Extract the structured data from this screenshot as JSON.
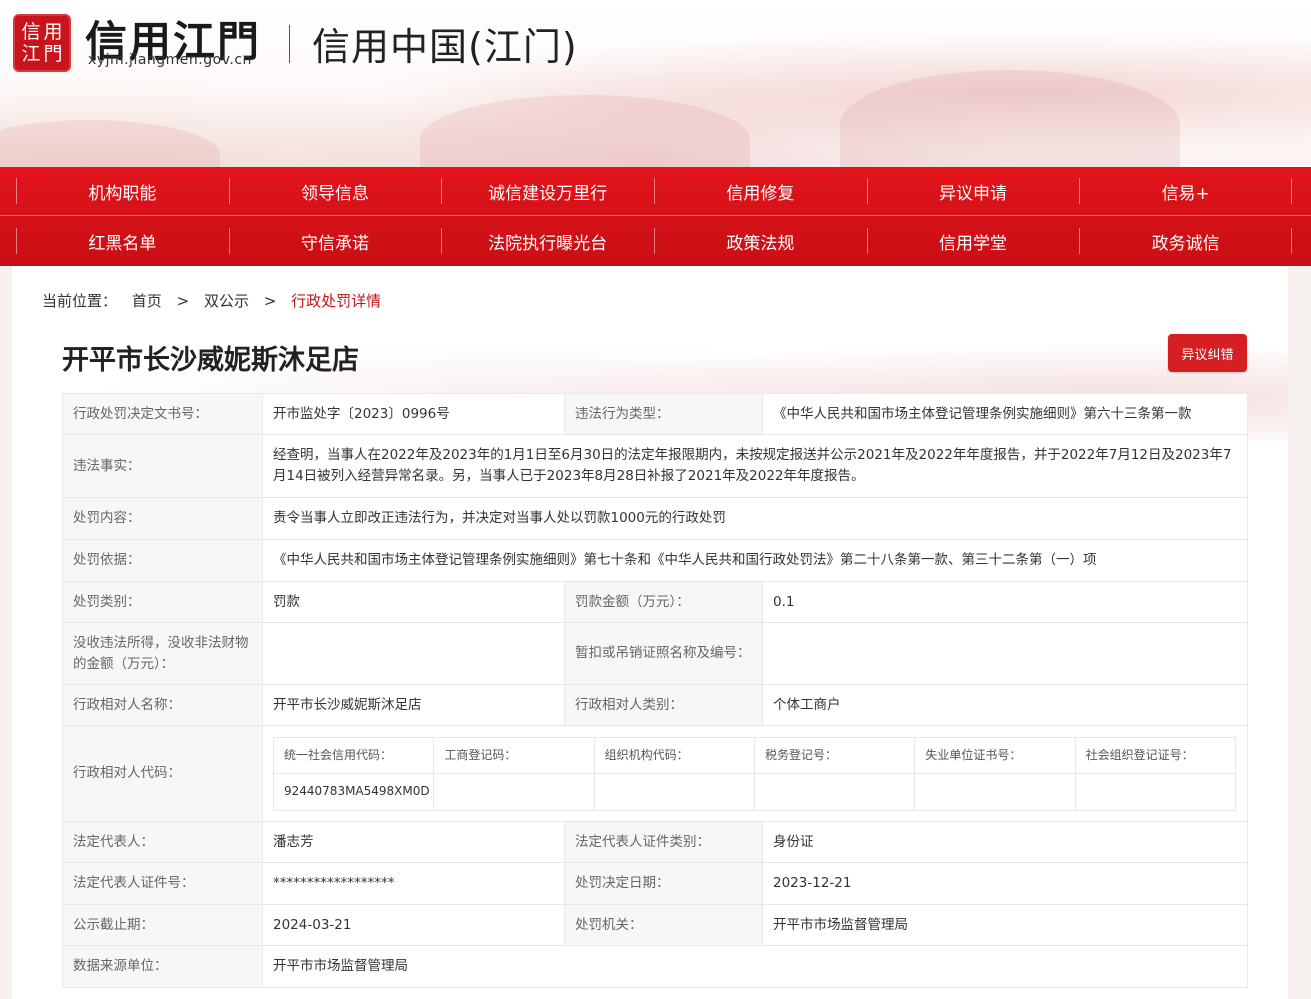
{
  "header": {
    "seal_chars": [
      "信",
      "用",
      "江",
      "門"
    ],
    "logo_text": "信用江門",
    "logo_domain": "xyjm.jiangmen.gov.cn",
    "site_name": "信用中国(江门)"
  },
  "nav": {
    "row1": [
      "机构职能",
      "领导信息",
      "诚信建设万里行",
      "信用修复",
      "异议申请",
      "信易+"
    ],
    "row2": [
      "红黑名单",
      "守信承诺",
      "法院执行曝光台",
      "政策法规",
      "信用学堂",
      "政务诚信"
    ]
  },
  "breadcrumb": {
    "label": "当前位置：",
    "home": "首页",
    "sep": ">",
    "section": "双公示",
    "current": "行政处罚详情"
  },
  "page": {
    "title": "开平市长沙威妮斯沐足店",
    "dispute_button": "异议纠错"
  },
  "detail": {
    "doc_no_label": "行政处罚决定文书号：",
    "doc_no": "开市监处字〔2023〕0996号",
    "violation_type_label": "违法行为类型：",
    "violation_type": "《中华人民共和国市场主体登记管理条例实施细则》第六十三条第一款",
    "facts_label": "违法事实：",
    "facts": "经查明，当事人在2022年及2023年的1月1日至6月30日的法定年报限期内，未按规定报送并公示2021年及2022年年度报告，并于2022年7月12日及2023年7月14日被列入经营异常名录。另，当事人已于2023年8月28日补报了2021年及2022年年度报告。",
    "content_label": "处罚内容：",
    "content": "责令当事人立即改正违法行为，并决定对当事人处以罚款1000元的行政处罚",
    "basis_label": "处罚依据：",
    "basis": "《中华人民共和国市场主体登记管理条例实施细则》第七十条和《中华人民共和国行政处罚法》第二十八条第一款、第三十二条第（一）项",
    "category_label": "处罚类别：",
    "category": "罚款",
    "fine_label": "罚款金额（万元）：",
    "fine": "0.1",
    "confiscated_label": "没收违法所得，没收非法财物的金额（万元）：",
    "confiscated": "",
    "license_label": "暂扣或吊销证照名称及编号：",
    "license": "",
    "party_name_label": "行政相对人名称：",
    "party_name": "开平市长沙威妮斯沐足店",
    "party_type_label": "行政相对人类别：",
    "party_type": "个体工商户",
    "party_code_label": "行政相对人代码：",
    "code_headers": [
      "统一社会信用代码：",
      "工商登记码：",
      "组织机构代码：",
      "税务登记号：",
      "失业单位证书号：",
      "社会组织登记证号："
    ],
    "code_values": [
      "92440783MA5498XM0D",
      "",
      "",
      "",
      "",
      ""
    ],
    "legal_rep_label": "法定代表人：",
    "legal_rep": "潘志芳",
    "legal_rep_id_type_label": "法定代表人证件类别：",
    "legal_rep_id_type": "身份证",
    "legal_rep_id_no_label": "法定代表人证件号：",
    "legal_rep_id_no": "******************",
    "decision_date_label": "处罚决定日期：",
    "decision_date": "2023-12-21",
    "publish_deadline_label": "公示截止期：",
    "publish_deadline": "2024-03-21",
    "authority_label": "处罚机关：",
    "authority": "开平市市场监督管理局",
    "source_label": "数据来源单位：",
    "source": "开平市市场监督管理局"
  }
}
